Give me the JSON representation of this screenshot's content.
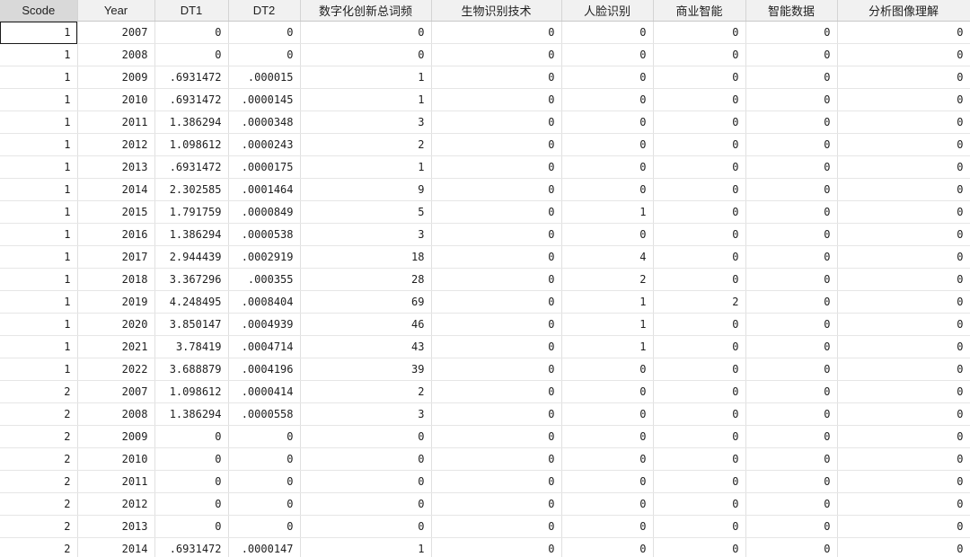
{
  "columns": [
    "Scode",
    "Year",
    "DT1",
    "DT2",
    "数字化创新总词频",
    "生物识别技术",
    "人脸识别",
    "商业智能",
    "智能数据",
    "分析图像理解"
  ],
  "rows": [
    [
      "1",
      "2007",
      "0",
      "0",
      "0",
      "0",
      "0",
      "0",
      "0",
      "0"
    ],
    [
      "1",
      "2008",
      "0",
      "0",
      "0",
      "0",
      "0",
      "0",
      "0",
      "0"
    ],
    [
      "1",
      "2009",
      ".6931472",
      ".000015",
      "1",
      "0",
      "0",
      "0",
      "0",
      "0"
    ],
    [
      "1",
      "2010",
      ".6931472",
      ".0000145",
      "1",
      "0",
      "0",
      "0",
      "0",
      "0"
    ],
    [
      "1",
      "2011",
      "1.386294",
      ".0000348",
      "3",
      "0",
      "0",
      "0",
      "0",
      "0"
    ],
    [
      "1",
      "2012",
      "1.098612",
      ".0000243",
      "2",
      "0",
      "0",
      "0",
      "0",
      "0"
    ],
    [
      "1",
      "2013",
      ".6931472",
      ".0000175",
      "1",
      "0",
      "0",
      "0",
      "0",
      "0"
    ],
    [
      "1",
      "2014",
      "2.302585",
      ".0001464",
      "9",
      "0",
      "0",
      "0",
      "0",
      "0"
    ],
    [
      "1",
      "2015",
      "1.791759",
      ".0000849",
      "5",
      "0",
      "1",
      "0",
      "0",
      "0"
    ],
    [
      "1",
      "2016",
      "1.386294",
      ".0000538",
      "3",
      "0",
      "0",
      "0",
      "0",
      "0"
    ],
    [
      "1",
      "2017",
      "2.944439",
      ".0002919",
      "18",
      "0",
      "4",
      "0",
      "0",
      "0"
    ],
    [
      "1",
      "2018",
      "3.367296",
      ".000355",
      "28",
      "0",
      "2",
      "0",
      "0",
      "0"
    ],
    [
      "1",
      "2019",
      "4.248495",
      ".0008404",
      "69",
      "0",
      "1",
      "2",
      "0",
      "0"
    ],
    [
      "1",
      "2020",
      "3.850147",
      ".0004939",
      "46",
      "0",
      "1",
      "0",
      "0",
      "0"
    ],
    [
      "1",
      "2021",
      "3.78419",
      ".0004714",
      "43",
      "0",
      "1",
      "0",
      "0",
      "0"
    ],
    [
      "1",
      "2022",
      "3.688879",
      ".0004196",
      "39",
      "0",
      "0",
      "0",
      "0",
      "0"
    ],
    [
      "2",
      "2007",
      "1.098612",
      ".0000414",
      "2",
      "0",
      "0",
      "0",
      "0",
      "0"
    ],
    [
      "2",
      "2008",
      "1.386294",
      ".0000558",
      "3",
      "0",
      "0",
      "0",
      "0",
      "0"
    ],
    [
      "2",
      "2009",
      "0",
      "0",
      "0",
      "0",
      "0",
      "0",
      "0",
      "0"
    ],
    [
      "2",
      "2010",
      "0",
      "0",
      "0",
      "0",
      "0",
      "0",
      "0",
      "0"
    ],
    [
      "2",
      "2011",
      "0",
      "0",
      "0",
      "0",
      "0",
      "0",
      "0",
      "0"
    ],
    [
      "2",
      "2012",
      "0",
      "0",
      "0",
      "0",
      "0",
      "0",
      "0",
      "0"
    ],
    [
      "2",
      "2013",
      "0",
      "0",
      "0",
      "0",
      "0",
      "0",
      "0",
      "0"
    ],
    [
      "2",
      "2014",
      ".6931472",
      ".0000147",
      "1",
      "0",
      "0",
      "0",
      "0",
      "0"
    ]
  ],
  "selected_cell": {
    "row": 0,
    "col": 0
  }
}
